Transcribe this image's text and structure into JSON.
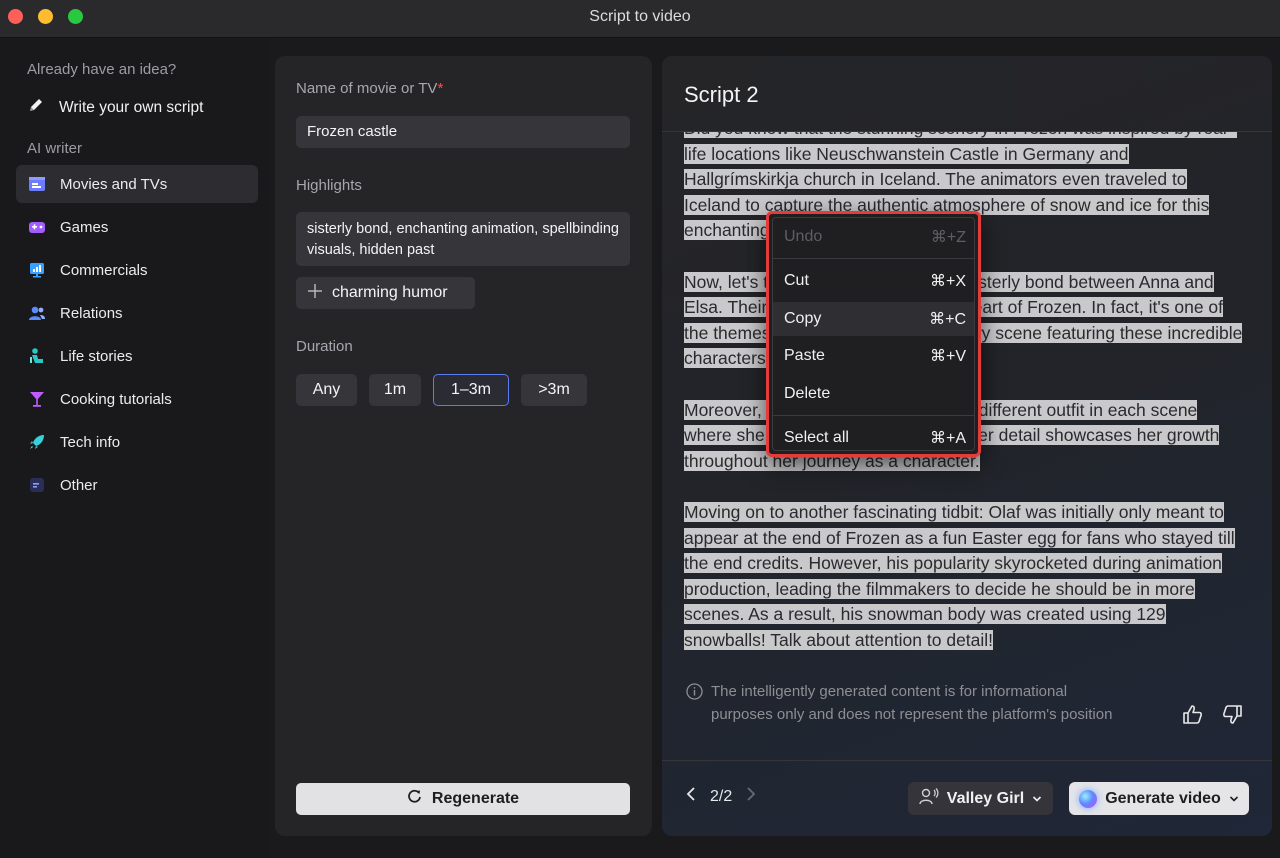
{
  "window": {
    "title": "Script to video"
  },
  "sidebar": {
    "idea_heading": "Already have an idea?",
    "write_own": "Write your own script",
    "ai_heading": "AI writer",
    "items": [
      {
        "label": "Movies and TVs",
        "icon": "clapperboard-icon",
        "color": "#6b7cff"
      },
      {
        "label": "Games",
        "icon": "gamepad-icon",
        "color": "#a25cff"
      },
      {
        "label": "Commercials",
        "icon": "chart-board-icon",
        "color": "#3aa0ff"
      },
      {
        "label": "Relations",
        "icon": "people-icon",
        "color": "#5b8cff"
      },
      {
        "label": "Life stories",
        "icon": "person-seat-icon",
        "color": "#28c8c8"
      },
      {
        "label": "Cooking tutorials",
        "icon": "cocktail-icon",
        "color": "#c05cff"
      },
      {
        "label": "Tech info",
        "icon": "rocket-icon",
        "color": "#3ad0d8"
      },
      {
        "label": "Other",
        "icon": "menu-box-icon",
        "color": "#5b6cff"
      }
    ]
  },
  "form": {
    "name_label": "Name of movie or TV",
    "required_mark": "*",
    "name_value": "Frozen castle",
    "highlights_label": "Highlights",
    "highlights_value": "sisterly bond, enchanting animation, spellbinding visuals, hidden past",
    "add_chip": "charming humor",
    "duration_label": "Duration",
    "durations": [
      "Any",
      "1m",
      "1–3m",
      ">3m"
    ],
    "selected_duration": "1–3m",
    "regenerate": "Regenerate"
  },
  "script": {
    "title": "Script 2",
    "paragraphs": [
      "Did you know that the stunning scenery in Frozen was inspired by real–life locations like Neuschwanstein Castle in Germany and Hallgrímskirkja church in Iceland. The animators even traveled to Iceland to capture the authentic atmosphere of snow and ice for this enchanting film!",
      "Now, let's talk about the remarkable sisterly bond between Anna and Elsa. Their bond is truly the beating heart of Frozen. In fact, it's one of the themes that shines through in every scene featuring these incredible characters.",
      "Moreover, did you know Elsa wears a different outfit in each scene where she sings \"Let It Go\"? This clever detail showcases her growth throughout her journey as a character.",
      "Moving on to another fascinating tidbit: Olaf was initially only meant to appear at the end of Frozen as a fun Easter egg for fans who stayed till the end credits. However, his popularity skyrocketed during animation production, leading the filmmakers to decide he should be in more scenes. As a result, his snowman body was created using 129 snowballs! Talk about attention to detail!"
    ],
    "notice": "The intelligently generated content is for informational purposes only and does not represent the platform's position",
    "pager": "2/2",
    "voice": "Valley Girl",
    "generate": "Generate video"
  },
  "context_menu": {
    "items": [
      {
        "label": "Undo",
        "shortcut": "⌘+Z",
        "disabled": true
      },
      {
        "label": "Cut",
        "shortcut": "⌘+X"
      },
      {
        "label": "Copy",
        "shortcut": "⌘+C",
        "hover": true
      },
      {
        "label": "Paste",
        "shortcut": "⌘+V"
      },
      {
        "label": "Delete",
        "shortcut": ""
      },
      {
        "label": "Select all",
        "shortcut": "⌘+A"
      }
    ]
  }
}
